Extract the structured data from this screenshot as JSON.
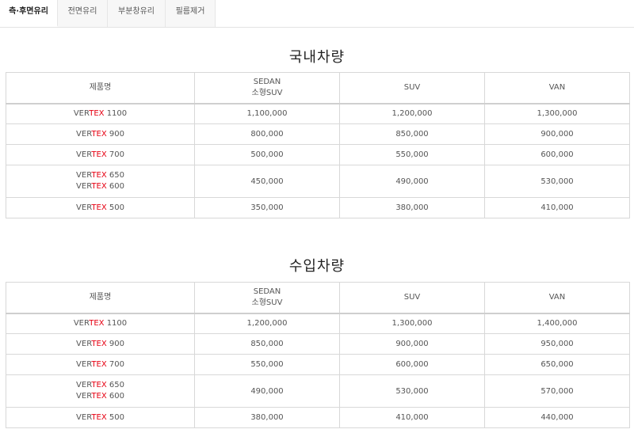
{
  "tabs": [
    {
      "label": "측·후면유리",
      "active": true
    },
    {
      "label": "전면유리",
      "active": false
    },
    {
      "label": "부분창유리",
      "active": false
    },
    {
      "label": "필름제거",
      "active": false
    }
  ],
  "sections": [
    {
      "title": "국내차량",
      "headers": {
        "product": "제품명",
        "sedan_line1": "SEDAN",
        "sedan_line2": "소형SUV",
        "suv": "SUV",
        "van": "VAN"
      },
      "rows": [
        {
          "product_a": "VERTEX 1100",
          "product_b": "",
          "sedan": "1,100,000",
          "suv": "1,200,000",
          "van": "1,300,000"
        },
        {
          "product_a": "VERTEX 900",
          "product_b": "",
          "sedan": "800,000",
          "suv": "850,000",
          "van": "900,000"
        },
        {
          "product_a": "VERTEX 700",
          "product_b": "",
          "sedan": "500,000",
          "suv": "550,000",
          "van": "600,000"
        },
        {
          "product_a": "VERTEX 650",
          "product_b": "VERTEX 600",
          "sedan": "450,000",
          "suv": "490,000",
          "van": "530,000"
        },
        {
          "product_a": "VERTEX 500",
          "product_b": "",
          "sedan": "350,000",
          "suv": "380,000",
          "van": "410,000"
        }
      ]
    },
    {
      "title": "수입차량",
      "headers": {
        "product": "제품명",
        "sedan_line1": "SEDAN",
        "sedan_line2": "소형SUV",
        "suv": "SUV",
        "van": "VAN"
      },
      "rows": [
        {
          "product_a": "VERTEX 1100",
          "product_b": "",
          "sedan": "1,200,000",
          "suv": "1,300,000",
          "van": "1,400,000"
        },
        {
          "product_a": "VERTEX 900",
          "product_b": "",
          "sedan": "850,000",
          "suv": "900,000",
          "van": "950,000"
        },
        {
          "product_a": "VERTEX 700",
          "product_b": "",
          "sedan": "550,000",
          "suv": "600,000",
          "van": "650,000"
        },
        {
          "product_a": "VERTEX 650",
          "product_b": "VERTEX 600",
          "sedan": "490,000",
          "suv": "530,000",
          "van": "570,000"
        },
        {
          "product_a": "VERTEX 500",
          "product_b": "",
          "sedan": "380,000",
          "suv": "410,000",
          "van": "440,000"
        }
      ]
    }
  ],
  "colors": {
    "brand_red": "#e60012",
    "border": "#d8d8d8"
  }
}
